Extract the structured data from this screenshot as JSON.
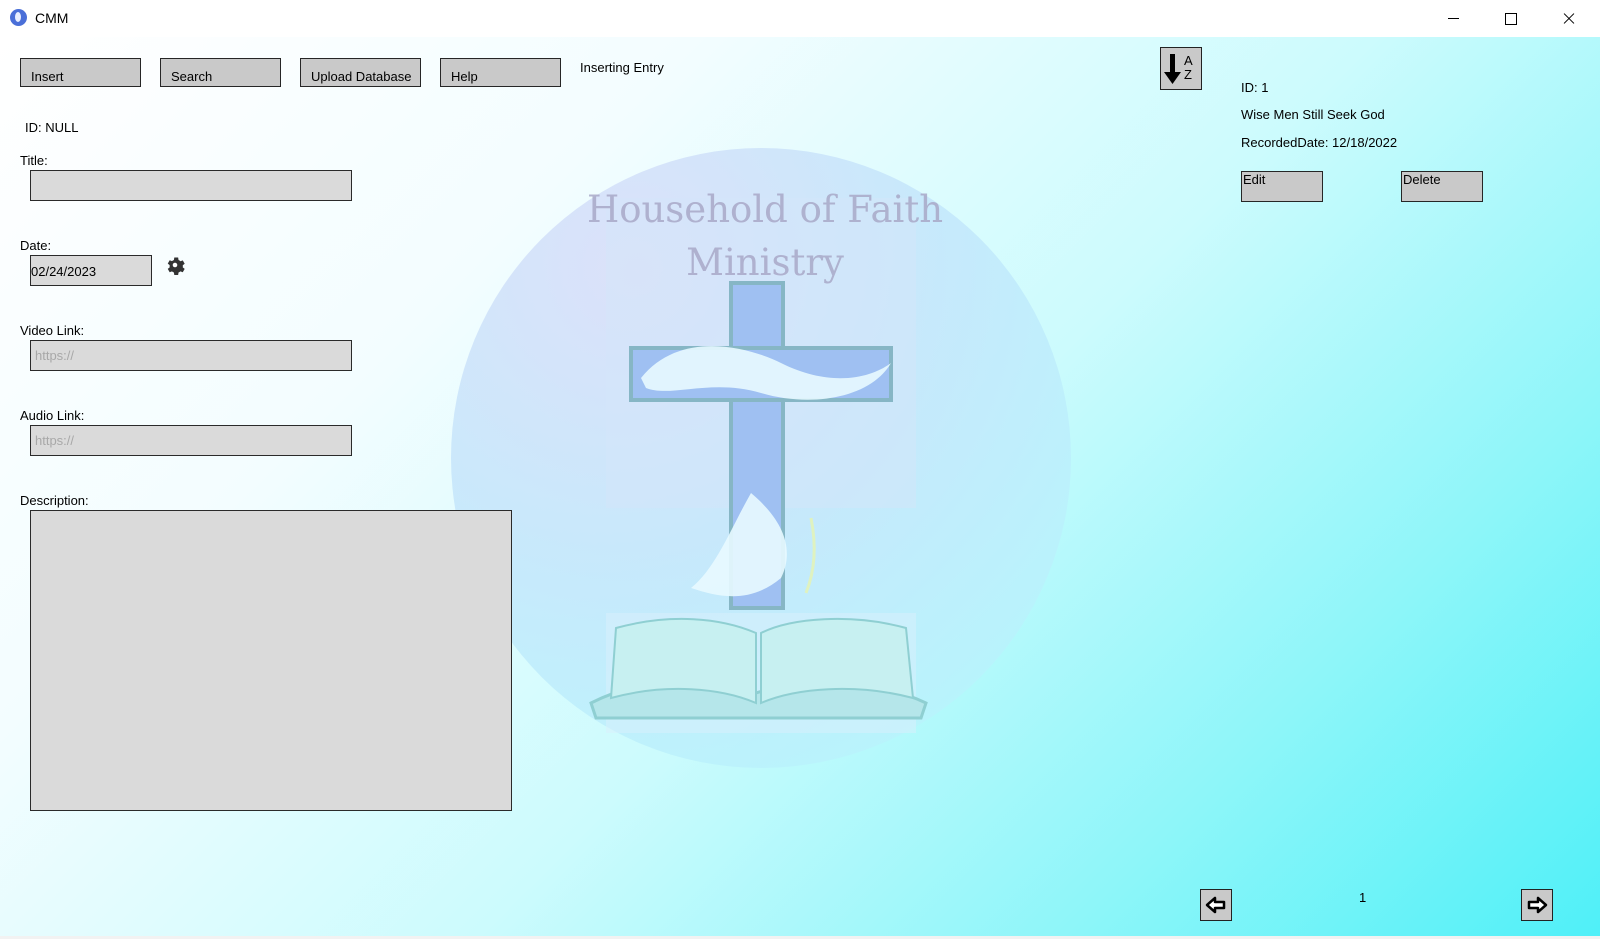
{
  "window": {
    "title": "CMM"
  },
  "toolbar": {
    "insert_label": "Insert",
    "search_label": "Search",
    "upload_label": "Upload Database",
    "help_label": "Help",
    "status": "Inserting Entry"
  },
  "form": {
    "id_text": "ID: NULL",
    "title_label": "Title:",
    "title_value": "",
    "date_label": "Date:",
    "date_value": "02/24/2023",
    "video_label": "Video Link:",
    "video_placeholder": "https://",
    "audio_label": "Audio Link:",
    "audio_placeholder": "https://",
    "description_label": "Description:",
    "description_value": ""
  },
  "logo": {
    "line1": "Household of Faith",
    "line2": "Ministry"
  },
  "sort": {
    "top_letter": "A",
    "bottom_letter": "Z"
  },
  "record": {
    "id_text": "ID: 1",
    "title": "Wise Men Still Seek God",
    "recorded_date": "RecordedDate: 12/18/2022",
    "edit_label": "Edit",
    "delete_label": "Delete"
  },
  "pagination": {
    "page": "1"
  }
}
